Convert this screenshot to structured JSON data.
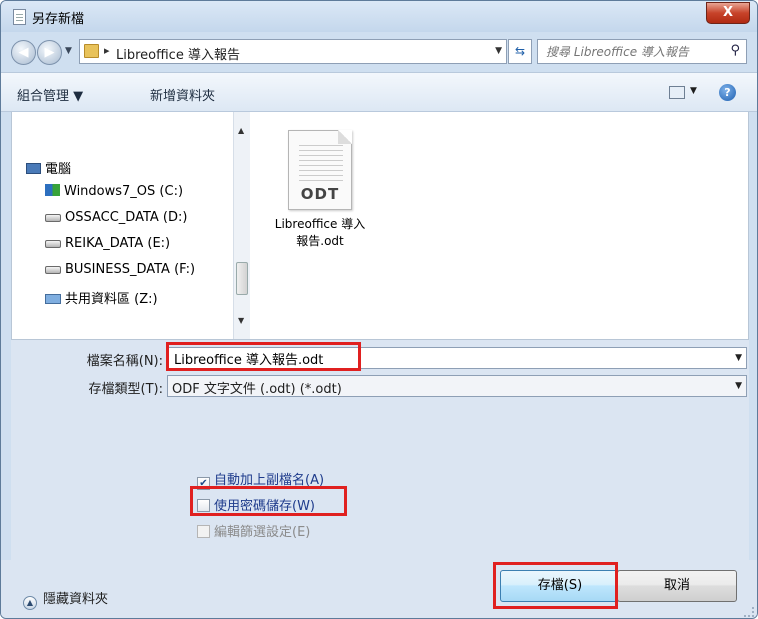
{
  "window": {
    "title": "另存新檔",
    "close_label": "X"
  },
  "address_bar": {
    "breadcrumb_separator": "▸",
    "path": "Libreoffice 導入報告",
    "search_placeholder": "搜尋 Libreoffice 導入報告"
  },
  "toolbar": {
    "organize_label": "組合管理 ▼",
    "new_folder_label": "新增資料夾",
    "help_label": "?"
  },
  "nav_tree": {
    "items": [
      {
        "label": "電腦",
        "icon": "computer-icon"
      },
      {
        "label": "Windows7_OS (C:)",
        "icon": "windows-drive-icon"
      },
      {
        "label": "OSSACC_DATA (D:)",
        "icon": "drive-icon"
      },
      {
        "label": "REIKA_DATA (E:)",
        "icon": "drive-icon"
      },
      {
        "label": "BUSINESS_DATA (F:)",
        "icon": "drive-icon"
      },
      {
        "label": "共用資料區 (Z:)",
        "icon": "network-drive-icon"
      }
    ]
  },
  "files": [
    {
      "name_line1": "Libreoffice 導入",
      "name_line2": "報告.odt",
      "badge": "ODT"
    }
  ],
  "form": {
    "filename_label": "檔案名稱(N):",
    "filename_value": "Libreoffice 導入報告.odt",
    "filetype_label": "存檔類型(T):",
    "filetype_value": "ODF 文字文件 (.odt) (*.odt)"
  },
  "options": {
    "auto_extension": {
      "label": "自動加上副檔名(A)",
      "checked": true
    },
    "save_with_password": {
      "label": "使用密碼儲存(W)",
      "checked": false
    },
    "edit_filter_settings": {
      "label": "編輯篩選設定(E)",
      "checked": false,
      "disabled": true
    }
  },
  "footer": {
    "hide_folders_label": "隱藏資料夾",
    "save_label": "存檔(S)",
    "cancel_label": "取消"
  },
  "colors": {
    "highlight_box": "#e02020",
    "dialog_bg": "#dbe5f2"
  }
}
